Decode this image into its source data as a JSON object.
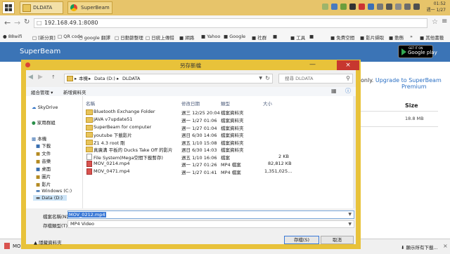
{
  "taskbar": {
    "tabs": [
      {
        "label": "DLDATA"
      },
      {
        "label": "SuperBeam - ..."
      }
    ],
    "clock_time": "01:52",
    "clock_date": "週一 1/27"
  },
  "browser": {
    "url": "192.168.49.1:8080",
    "bookmarks": [
      "88wifi",
      "[新分頁]",
      "QR code",
      "google 翻譯",
      "日動篩整理",
      "日統上傳錯",
      "網路",
      "Yahoo",
      "Google",
      "社群",
      "",
      "工具",
      "",
      "免費空間",
      "影片擷取",
      "動態",
      "",
      "其他書籤"
    ]
  },
  "page": {
    "brand_title": "SuperBeam",
    "gplay_small": "GET IT ON",
    "gplay_big": "Google play",
    "upgrade_prefix": "only.",
    "upgrade_link": "Upgrade to SuperBeam",
    "upgrade_tail": "Premium",
    "size_header": "Size",
    "size_value": "18.8 MB",
    "bottom_file": "MO",
    "show_all_downloads": "顯示所有下載..."
  },
  "dialog": {
    "title": "另存新檔",
    "path": [
      "本機",
      "Data (D:)",
      "DLDATA"
    ],
    "search_placeholder": "搜尋 DLDATA",
    "toolbar": {
      "organize": "組合管理",
      "new_folder": "新增資料夾"
    },
    "nav_items": [
      {
        "label": "SkyDrive",
        "icon": "skydrive-icon"
      },
      {
        "label": "家用群組",
        "icon": "homegroup-icon"
      },
      {
        "label": "本機",
        "icon": "computer-icon"
      },
      {
        "label": "下載",
        "icon": "download-folder-icon"
      },
      {
        "label": "文件",
        "icon": "documents-folder-icon"
      },
      {
        "label": "音樂",
        "icon": "music-folder-icon"
      },
      {
        "label": "桌面",
        "icon": "desktop-folder-icon"
      },
      {
        "label": "圖片",
        "icon": "pictures-folder-icon"
      },
      {
        "label": "影片",
        "icon": "videos-folder-icon"
      },
      {
        "label": "Windows (C:)",
        "icon": "drive-icon"
      },
      {
        "label": "Data (D:)",
        "icon": "drive-icon"
      }
    ],
    "columns": {
      "name": "名稱",
      "date": "修改日期",
      "type": "類型",
      "size": "大小"
    },
    "files": [
      {
        "name": "Bluetooth Exchange Folder",
        "date": "週三 12/25 20:04",
        "type": "檔案資料夾",
        "size": "",
        "kind": "folder"
      },
      {
        "name": "JAVA v7update51",
        "date": "週一 1/27 01:06",
        "type": "檔案資料夾",
        "size": "",
        "kind": "folder"
      },
      {
        "name": "SuperBeam for computer",
        "date": "週一 1/27 01:04",
        "type": "檔案資料夾",
        "size": "",
        "kind": "folder"
      },
      {
        "name": "youtube 下載影片",
        "date": "週日 6/30 14:06",
        "type": "檔案資料夾",
        "size": "",
        "kind": "folder"
      },
      {
        "name": "Z1 4.3 root 剛",
        "date": "週五 1/10 15:08",
        "type": "檔案資料夾",
        "size": "",
        "kind": "folder"
      },
      {
        "name": "真廣溝 平板的 Ducks Take Off 的影片",
        "date": "週日 6/30 14:03",
        "type": "檔案資料夾",
        "size": "",
        "kind": "folder"
      },
      {
        "name": "File System(Mega空間下載暫存)",
        "date": "週五 1/10 16:06",
        "type": "檔案",
        "size": "2 KB",
        "kind": "file"
      },
      {
        "name": "MOV_0214.mp4",
        "date": "週一 1/27 01:26",
        "type": "MP4 檔案",
        "size": "82,812 KB",
        "kind": "mp4"
      },
      {
        "name": "MOV_0471.mp4",
        "date": "週一 1/27 01:41",
        "type": "MP4 檔案",
        "size": "1,351,025...",
        "kind": "mp4"
      }
    ],
    "filename_label": "檔案名稱(N):",
    "filename_value": "MOV_0212.mp4",
    "filetype_label": "存檔類型(T):",
    "filetype_value": "MP4 Video",
    "hide_folders": "隱藏資料夾",
    "save_button": "存檔(S)",
    "cancel_button": "取消"
  }
}
